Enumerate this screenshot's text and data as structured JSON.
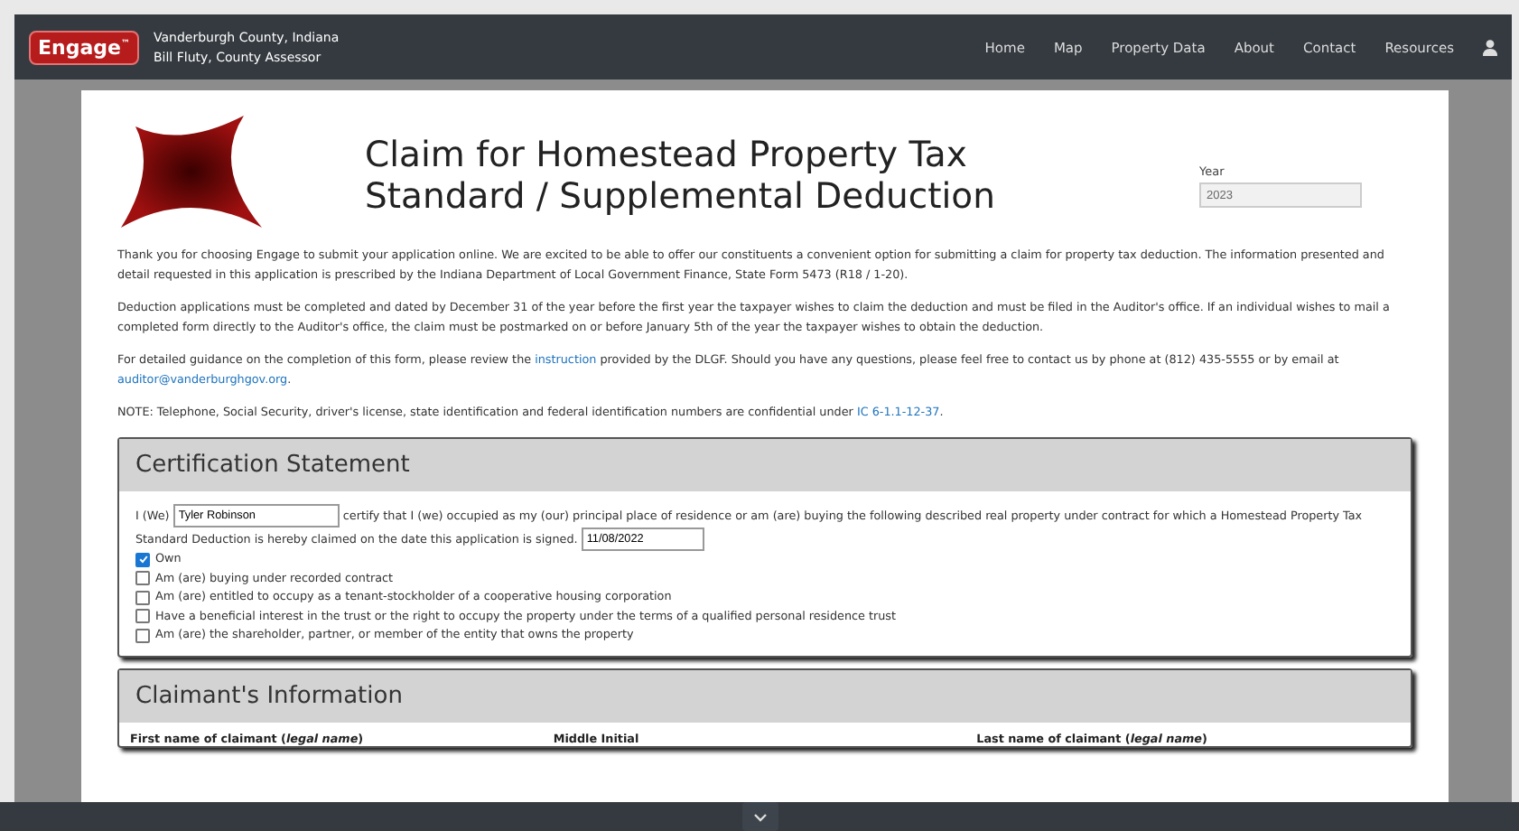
{
  "header": {
    "logo": "Engage",
    "logo_mark": "™",
    "county": "Vanderburgh County, Indiana",
    "assessor": "Bill Fluty, County Assessor",
    "nav": [
      "Home",
      "Map",
      "Property Data",
      "About",
      "Contact",
      "Resources"
    ]
  },
  "form": {
    "title": "Claim for Homestead Property Tax Standard / Supplemental Deduction",
    "year_label": "Year",
    "year_value": "2023",
    "paragraphs": [
      {
        "text": "Thank you for choosing Engage to submit your application online. We are excited to be able to offer our constituents a convenient option for submitting a claim for property tax deduction. The information presented and detail requested in this application is prescribed by the Indiana Department of Local Government Finance, State Form 5473 (R18 / 1-20)."
      },
      {
        "text": "Deduction applications must be completed and dated by December 31 of the year before the first year the taxpayer wishes to claim the deduction and must be filed in the Auditor's office. If an individual wishes to mail a completed form directly to the Auditor's office, the claim must be postmarked on or before January 5th of the year the taxpayer wishes to obtain the deduction."
      },
      {
        "parts": [
          {
            "text": "For detailed guidance on the completion of this form, please review the "
          },
          {
            "link": "instruction"
          },
          {
            "text": " provided by the DLGF. Should you have any questions, please feel free to contact us by phone at (812) 435-5555 or by email at "
          },
          {
            "link": "auditor@vanderburghgov.org"
          },
          {
            "text": "."
          }
        ]
      },
      {
        "parts": [
          {
            "text": "NOTE: Telephone, Social Security, driver's license, state identification and federal identification numbers are confidential under "
          },
          {
            "link": "IC 6-1.1-12-37"
          },
          {
            "text": "."
          }
        ]
      }
    ],
    "certification": {
      "heading": "Certification Statement",
      "prefix": "I (We)",
      "name_value": "Tyler Robinson",
      "statement": "certify that I (we) occupied as my (our) principal place of residence or am (are) buying the following described real property under contract for which a Homestead Property Tax Standard Deduction is hereby claimed on the date this application is signed.",
      "date_value": "11/08/2022",
      "options": [
        {
          "label": "Own",
          "checked": true
        },
        {
          "label": "Am (are) buying under recorded contract",
          "checked": false
        },
        {
          "label": "Am (are) entitled to occupy as a tenant-stockholder of a cooperative housing corporation",
          "checked": false
        },
        {
          "label": "Have a beneficial interest in the trust or the right to occupy the property under the terms of a qualified personal residence trust",
          "checked": false
        },
        {
          "label": "Am (are) the shareholder, partner, or member of the entity that owns the property",
          "checked": false
        }
      ]
    },
    "claimant": {
      "heading": "Claimant's Information",
      "fields": [
        "First name of claimant (*legal name*)",
        "Middle Initial",
        "Last name of claimant (*legal name*)"
      ]
    }
  }
}
